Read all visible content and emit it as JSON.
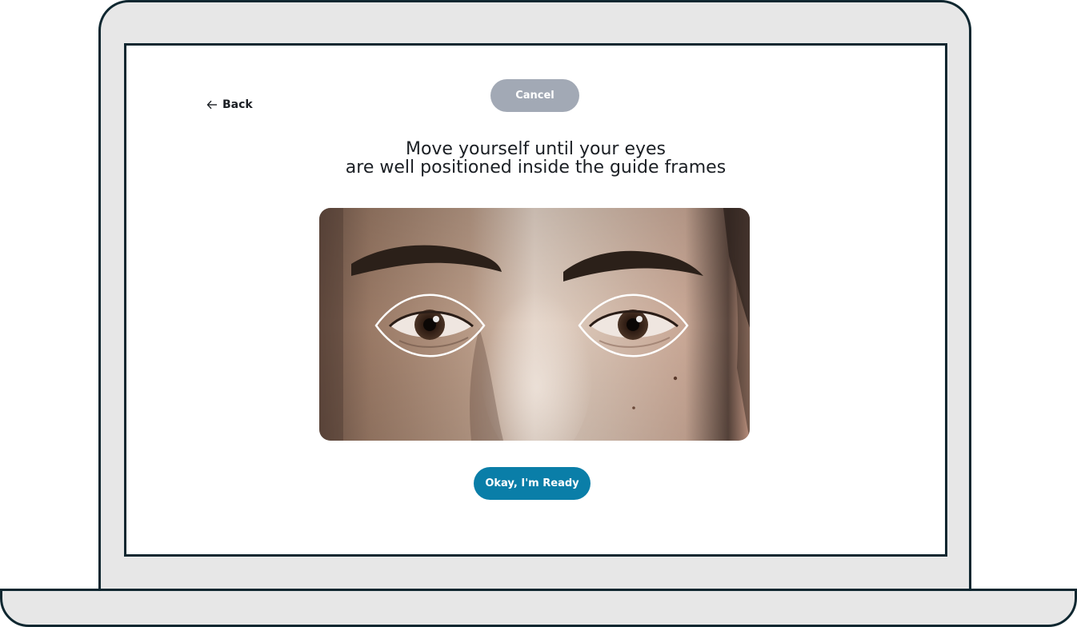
{
  "nav": {
    "back_label": "Back",
    "back_icon": "arrow-left-icon"
  },
  "actions": {
    "cancel_label": "Cancel",
    "ready_label": "Okay, I'm Ready"
  },
  "instruction": {
    "line1": "Move yourself until your eyes",
    "line2": "are well positioned inside the guide frames"
  },
  "camera": {
    "guide_frames": [
      "left-eye-guide",
      "right-eye-guide"
    ]
  },
  "colors": {
    "bezel": "#e7e7e7",
    "outline": "#0f2730",
    "cancel_bg": "#a2a9b5",
    "primary": "#0a7ea8",
    "text": "#1b1f24"
  }
}
